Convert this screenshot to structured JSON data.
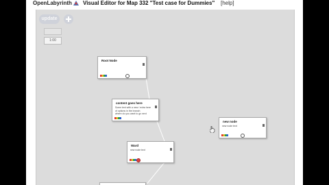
{
  "header": {
    "brand": "OpenLabyrinth",
    "title": "Visual Editor for Map 332 \"Test case for Dummies\"",
    "help_link": "[help]"
  },
  "toolbar": {
    "update_label": "update",
    "add_icon": "plus-icon",
    "control_value": "1:00"
  },
  "nodes": [
    {
      "title": "Root Node",
      "body": ""
    },
    {
      "title": "content goes here",
      "body": "Some text with a new / extra here\nof options in the branch\nwhere do you want to go next"
    },
    {
      "title": "Ward",
      "body": "new node text"
    },
    {
      "title": "new node",
      "body": "new node text"
    }
  ],
  "colors": {
    "canvas": "#dcdcdc",
    "node": "#ffffff",
    "link": "#ffffff",
    "button": "#cfd2da"
  }
}
